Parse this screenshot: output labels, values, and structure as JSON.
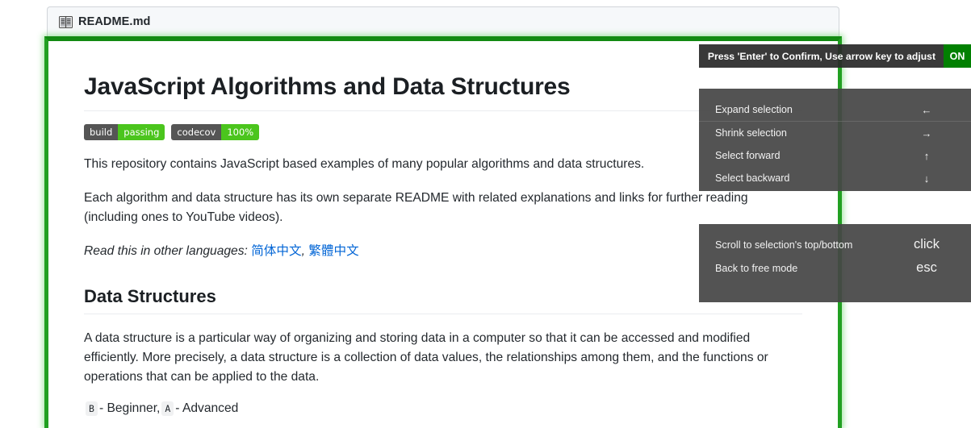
{
  "file_tab": {
    "icon": "open-book-icon",
    "label": "README.md"
  },
  "document": {
    "title": "JavaScript Algorithms and Data Structures",
    "badges": [
      {
        "name": "build-badge",
        "left": "build",
        "right": "passing"
      },
      {
        "name": "codecov-badge",
        "left": "codecov",
        "right": "100%"
      }
    ],
    "paragraph_1": "This repository contains JavaScript based examples of many popular algorithms and data structures.",
    "paragraph_2": "Each algorithm and data structure has its own separate README with related explanations and links for further reading (including ones to YouTube videos).",
    "languages_prefix": "Read this in other languages:",
    "language_links": [
      {
        "label": "简体中文"
      },
      {
        "label": "繁體中文"
      }
    ],
    "languages_separator": ",",
    "section_heading": "Data Structures",
    "paragraph_3": "A data structure is a particular way of organizing and storing data in a computer so that it can be accessed and modified efficiently. More precisely, a data structure is a collection of data values, the relationships among them, and the functions or operations that can be applied to the data.",
    "legend": {
      "beginner_chip": "B",
      "beginner_text": "- Beginner,",
      "advanced_chip": "A",
      "advanced_text": "- Advanced"
    }
  },
  "overlay": {
    "hint": {
      "message": "Press 'Enter' to Confirm, Use arrow key to adjust",
      "state": "ON"
    },
    "primary_shortcuts": [
      {
        "name": "expand-selection",
        "label": "Expand selection",
        "key": "←"
      },
      {
        "name": "shrink-selection",
        "label": "Shrink selection",
        "key": "→"
      },
      {
        "name": "select-forward",
        "label": "Select forward",
        "key": "↑"
      },
      {
        "name": "select-backward",
        "label": "Select backward",
        "key": "↓"
      }
    ],
    "secondary_shortcuts": [
      {
        "name": "scroll-to-selection",
        "label": "Scroll to selection's top/bottom",
        "key": "click"
      },
      {
        "name": "back-to-free-mode",
        "label": "Back to free mode",
        "key": "esc"
      }
    ]
  },
  "colors": {
    "selection_green": "#22a022",
    "state_green": "#018001",
    "badge_green": "#4bc51d",
    "badge_gray": "#555555",
    "link_blue": "#0366d6",
    "overlay_dark": "#2a2a2a",
    "overlay_panel": "#464646"
  }
}
